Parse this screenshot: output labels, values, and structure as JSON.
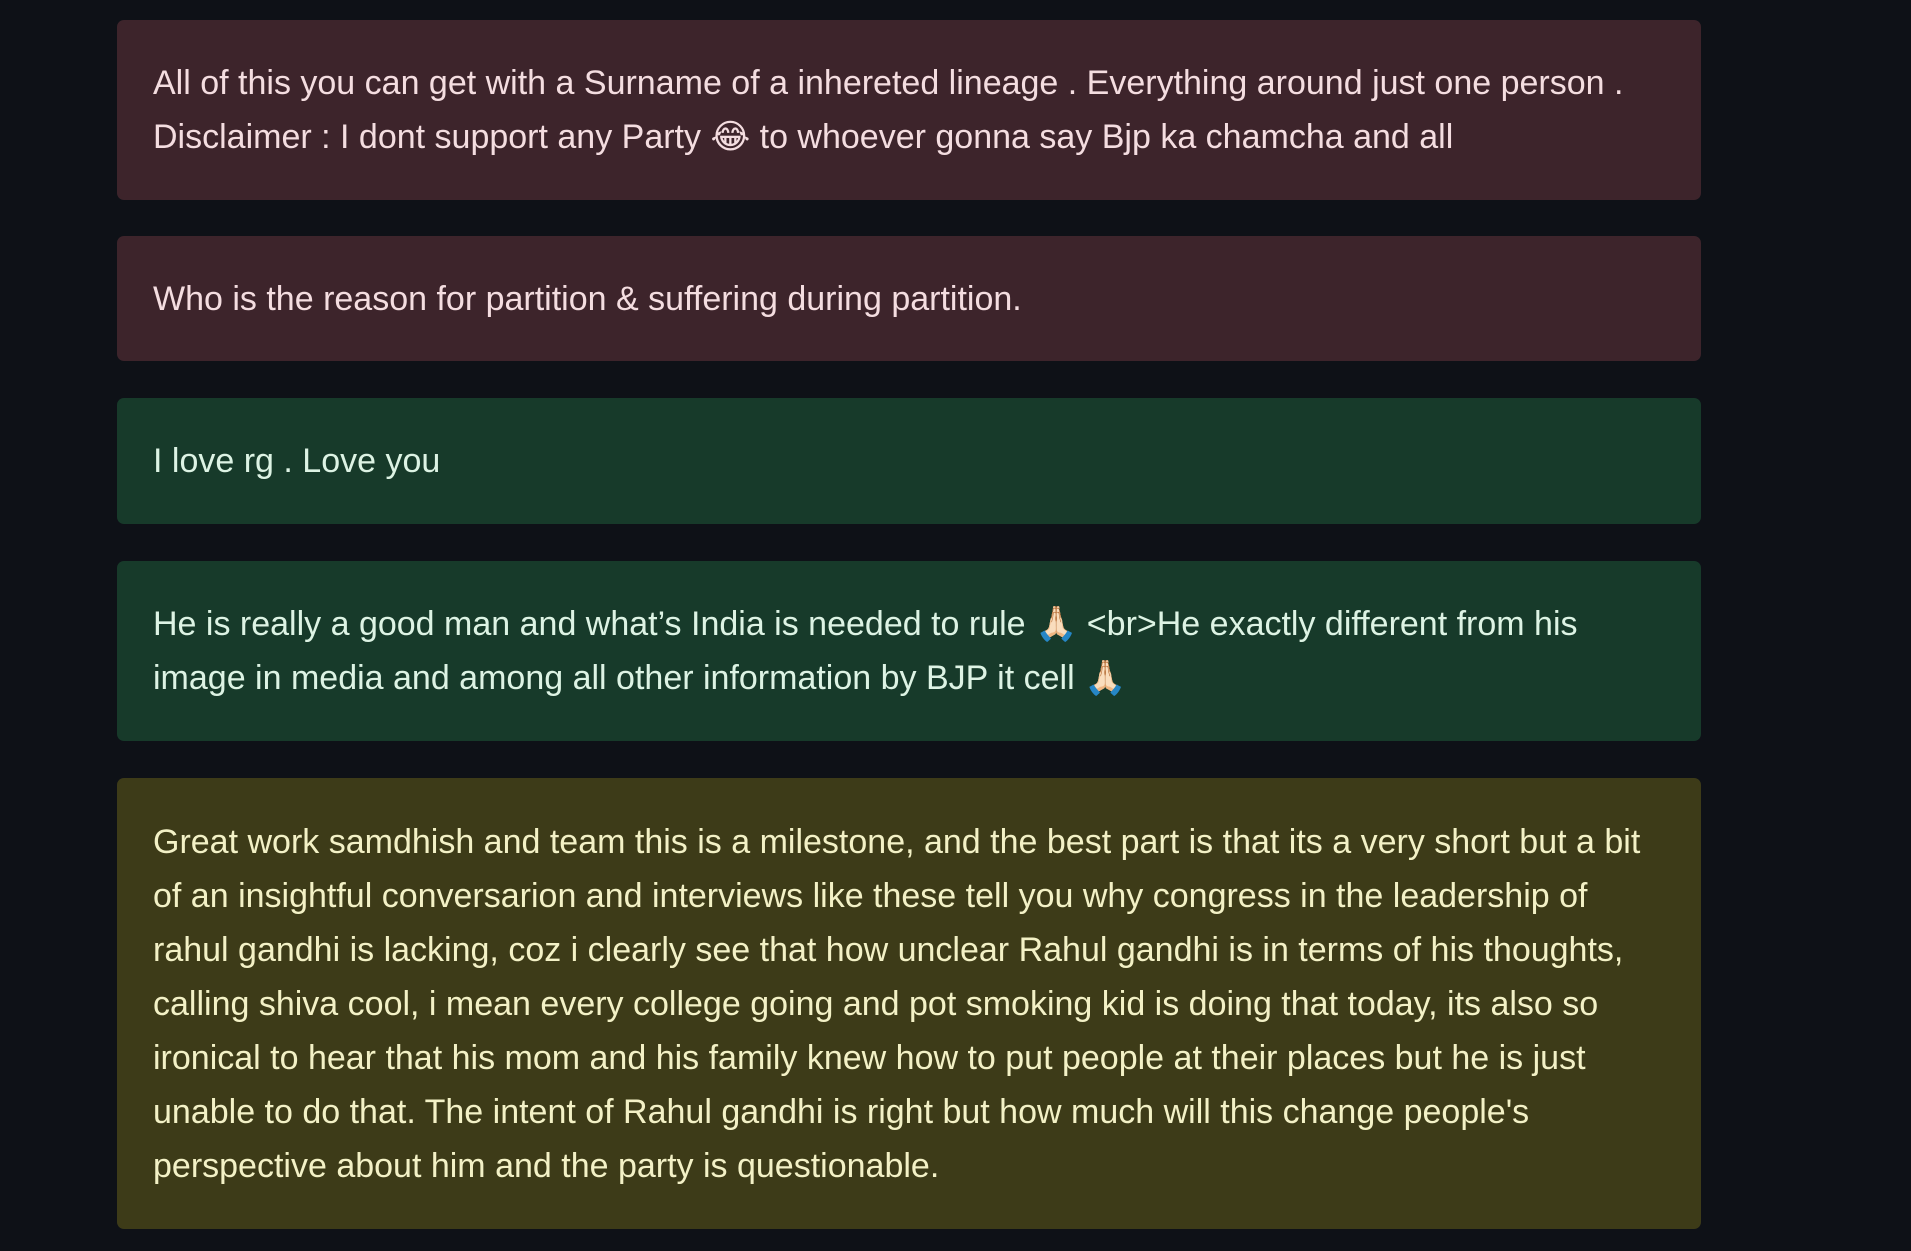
{
  "comments": [
    {
      "sentiment": "negative",
      "text": "All of this you can get with a Surname of a inhereted lineage . Everything around just one person . Disclaimer : I dont support any Party 😂 to whoever gonna say Bjp ka chamcha and all"
    },
    {
      "sentiment": "negative",
      "text": "Who is the reason for partition & suffering during partition."
    },
    {
      "sentiment": "positive",
      "text": "I love rg . Love you"
    },
    {
      "sentiment": "positive",
      "text": "He is really a good man and what’s India is needed to rule 🙏🏻 <br>He exactly different from his image in media and among all other information by BJP it cell 🙏🏻"
    },
    {
      "sentiment": "neutral",
      "text": "Great work samdhish and team this is a milestone, and the best part is that its a very short but a bit of an insightful conversarion and interviews like these tell you why congress in the leadership of rahul gandhi is lacking, coz i clearly see that how unclear Rahul gandhi is in terms of his thoughts, calling shiva cool, i mean every college going and pot smoking kid is doing that today, its also so ironical to hear that his mom and his family knew how to put people at their places but he is just unable to do that. The intent of Rahul gandhi is right but how much will this change people's perspective about him and the party is questionable."
    }
  ],
  "colors": {
    "page_background": "#0e1117",
    "negative_card": "#3d242b",
    "positive_card": "#173a2a",
    "neutral_card": "#3d3b18"
  }
}
